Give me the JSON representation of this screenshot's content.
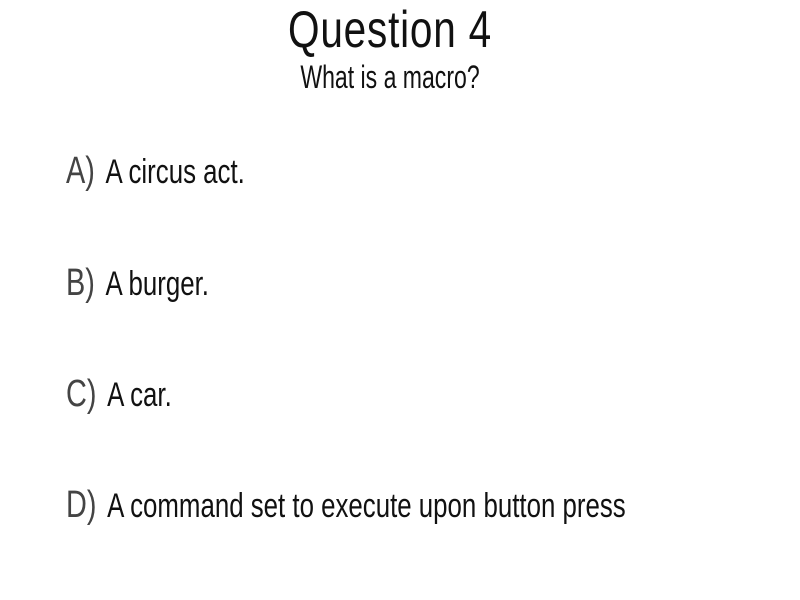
{
  "slide": {
    "title": "Question 4",
    "question": "What is a macro?",
    "options": [
      {
        "letter": "A)",
        "text": "A circus act."
      },
      {
        "letter": "B)",
        "text": "A burger."
      },
      {
        "letter": "C)",
        "text": "A car."
      },
      {
        "letter": "D)",
        "text": "A command set to execute upon button press"
      }
    ]
  }
}
